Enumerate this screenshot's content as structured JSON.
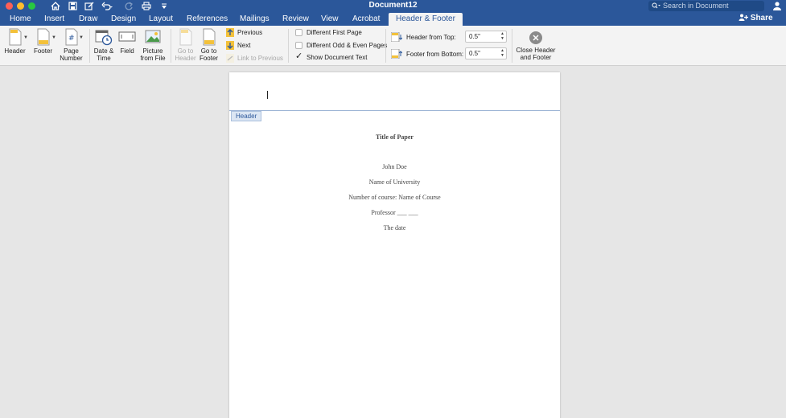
{
  "window": {
    "title": "Document12",
    "search_placeholder": "Search in Document",
    "share_label": "Share"
  },
  "tabs": [
    "Home",
    "Insert",
    "Draw",
    "Design",
    "Layout",
    "References",
    "Mailings",
    "Review",
    "View",
    "Acrobat",
    "Header & Footer"
  ],
  "active_tab": "Header & Footer",
  "ribbon": {
    "header_label": "Header",
    "footer_label": "Footer",
    "page_number_label_1": "Page",
    "page_number_label_2": "Number",
    "date_time_label_1": "Date &",
    "date_time_label_2": "Time",
    "field_label": "Field",
    "picture_label_1": "Picture",
    "picture_label_2": "from File",
    "go_header_label_1": "Go to",
    "go_header_label_2": "Header",
    "go_footer_label_1": "Go to",
    "go_footer_label_2": "Footer",
    "previous_label": "Previous",
    "next_label": "Next",
    "link_previous_label": "Link to Previous",
    "diff_first_page_label": "Different First Page",
    "diff_odd_even_label": "Different Odd & Even Pages",
    "show_doc_text_label": "Show Document Text",
    "diff_first_page_checked": false,
    "diff_odd_even_checked": false,
    "show_doc_text_checked": true,
    "header_from_top_label": "Header from Top:",
    "header_from_top_value": "0.5\"",
    "footer_from_bottom_label": "Footer from Bottom:",
    "footer_from_bottom_value": "0.5\"",
    "close_label_1": "Close Header",
    "close_label_2": "and Footer"
  },
  "document": {
    "header_tag": "Header",
    "title": "Title of Paper",
    "lines": [
      "John Doe",
      "Name of University",
      "Number of course: Name of Course",
      "Professor ___ ___",
      "The date"
    ]
  },
  "colors": {
    "accent": "#2b579a",
    "ribbon_bg": "#f3f3f3",
    "canvas_bg": "#e6e6e6"
  }
}
